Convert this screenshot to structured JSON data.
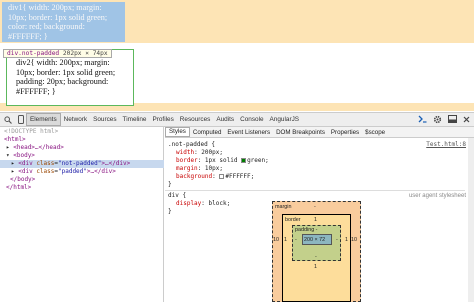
{
  "preview": {
    "div1_lines": [
      "div1{ width: 200px; margin:",
      "10px; border: 1px solid green;",
      "color: red; background:",
      "#FFFFFF; }"
    ],
    "tooltip_tag": "div.not-padded",
    "tooltip_size": "202px × 74px",
    "div2_lines": [
      "div2{ width: 200px; margin:",
      "10px; border: 1px solid green;",
      "padding: 20px; background:",
      "#FFFFFF; }"
    ]
  },
  "toolbar": {
    "tabs": [
      "Elements",
      "Network",
      "Sources",
      "Timeline",
      "Profiles",
      "Resources",
      "Audits",
      "Console",
      "AngularJS"
    ],
    "active_tab": "Elements",
    "icons": [
      "search-icon",
      "device-icon",
      "console-drawer-icon",
      "gear-icon",
      "dock-icon",
      "close-icon"
    ]
  },
  "dom_tree": {
    "doctype": "<!DOCTYPE html>",
    "html_open": "<html>",
    "head": "<head>…</head>",
    "body_open": "<body>",
    "div1_tag_open": "<div ",
    "div1_attr_name": "class",
    "div1_attr_value": "\"not-padded\"",
    "div1_tag_close": ">…</div>",
    "div2_tag_open": "<div ",
    "div2_attr_name": "class",
    "div2_attr_value": "\"padded\"",
    "div2_tag_close": ">…</div>",
    "body_close": "</body>",
    "html_close": "</html>"
  },
  "styles_pane": {
    "subtabs": [
      "Styles",
      "Computed",
      "Event Listeners",
      "DOM Breakpoints",
      "Properties",
      "$scope"
    ],
    "active_subtab": "Styles",
    "rule1": {
      "selector": ".not-padded {",
      "source": "Test.html:8",
      "props": [
        {
          "name": "width",
          "value": "200px;"
        },
        {
          "name": "border",
          "value": "1px solid",
          "swatch": "#008000",
          "value2": "green;"
        },
        {
          "name": "margin",
          "value": "10px;"
        },
        {
          "name": "background",
          "value": "",
          "swatch": "#FFFFFF",
          "value2": "#FFFFFF;"
        }
      ],
      "close": "}"
    },
    "rule2": {
      "selector": "div {",
      "source": "user agent stylesheet",
      "props": [
        {
          "name": "display",
          "value": "block;"
        }
      ],
      "close": "}"
    },
    "box_model": {
      "margin_label": "margin",
      "border_label": "border",
      "padding_label": "padding -",
      "content": "200 × 72",
      "margin": "10",
      "border": "1",
      "padding": "-",
      "margin_dash": "-"
    }
  },
  "colors": {
    "preview_bg": "#fde4b5",
    "highlight": "#a0c4e6",
    "selected_row": "#c7d8ee",
    "bm_margin": "#f9cc9d",
    "bm_border": "#fddd9b",
    "bm_padding": "#c3d08b",
    "bm_content": "#8cb6c0"
  }
}
